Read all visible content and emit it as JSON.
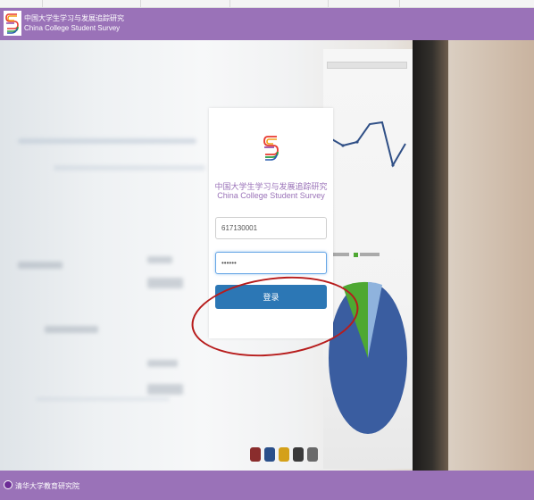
{
  "header": {
    "title_cn": "中国大学生学习与发展追踪研究",
    "title_en": "China College Student Survey"
  },
  "login": {
    "title_cn": "中国大学生学习与发展追踪研究",
    "title_en": "China College Student Survey",
    "username_value": "617130001",
    "password_value": "••••••",
    "submit_label": "登录"
  },
  "footer": {
    "org": "清华大学教育研究院"
  },
  "colors": {
    "brand_purple": "#9a72b8",
    "button_blue": "#2c77b5",
    "annotation_red": "#b71c1c"
  }
}
